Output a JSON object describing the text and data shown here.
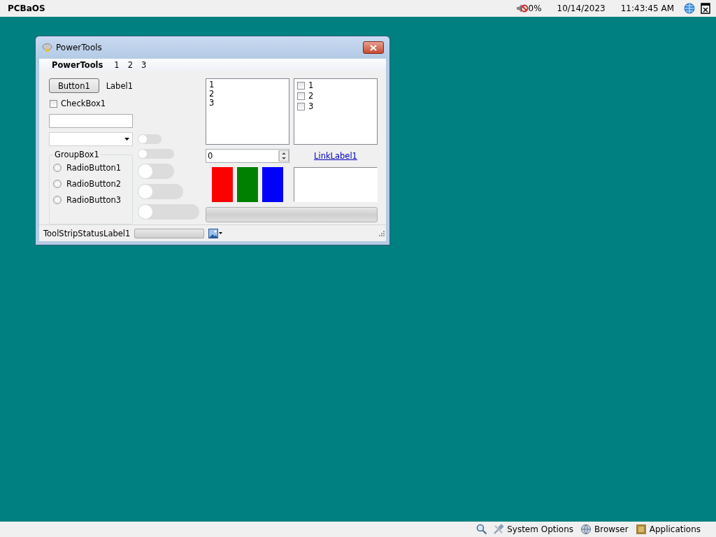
{
  "top_bar": {
    "os_name": "PCBaOS",
    "volume": "0%",
    "muted": true,
    "date": "10/14/2023",
    "time": "11:43:45 AM"
  },
  "window": {
    "title": "PowerTools",
    "menu": [
      {
        "label": "PowerTools",
        "kind": "app"
      },
      {
        "label": "1",
        "kind": "item"
      },
      {
        "label": "2",
        "kind": "item"
      },
      {
        "label": "3",
        "kind": "item"
      }
    ],
    "button": "Button1",
    "label": "Label1",
    "checkbox": {
      "label": "CheckBox1",
      "checked": false
    },
    "group_box": {
      "title": "GroupBox1",
      "radios": [
        {
          "label": "RadioButton1",
          "selected": false
        },
        {
          "label": "RadioButton2",
          "selected": false
        },
        {
          "label": "RadioButton3",
          "selected": false
        }
      ]
    },
    "toggles": [
      {
        "on": false
      },
      {
        "on": false
      },
      {
        "on": false
      },
      {
        "on": false
      },
      {
        "on": false
      }
    ],
    "list_box": [
      "1",
      "2",
      "3"
    ],
    "checked_list": [
      {
        "label": "1",
        "checked": false
      },
      {
        "label": "2",
        "checked": false
      },
      {
        "label": "3",
        "checked": false
      }
    ],
    "numeric": "0",
    "link": "LinkLabel1",
    "swatches": [
      {
        "color": "#ff0000"
      },
      {
        "color": "#008000"
      },
      {
        "color": "#0000ff"
      }
    ],
    "progress": {
      "level": 0
    },
    "status_bar": {
      "label": "ToolStripStatusLabel1",
      "progress": {
        "level": 0
      }
    }
  },
  "taskbar": [
    "System Options",
    "Browser",
    "Applications"
  ]
}
